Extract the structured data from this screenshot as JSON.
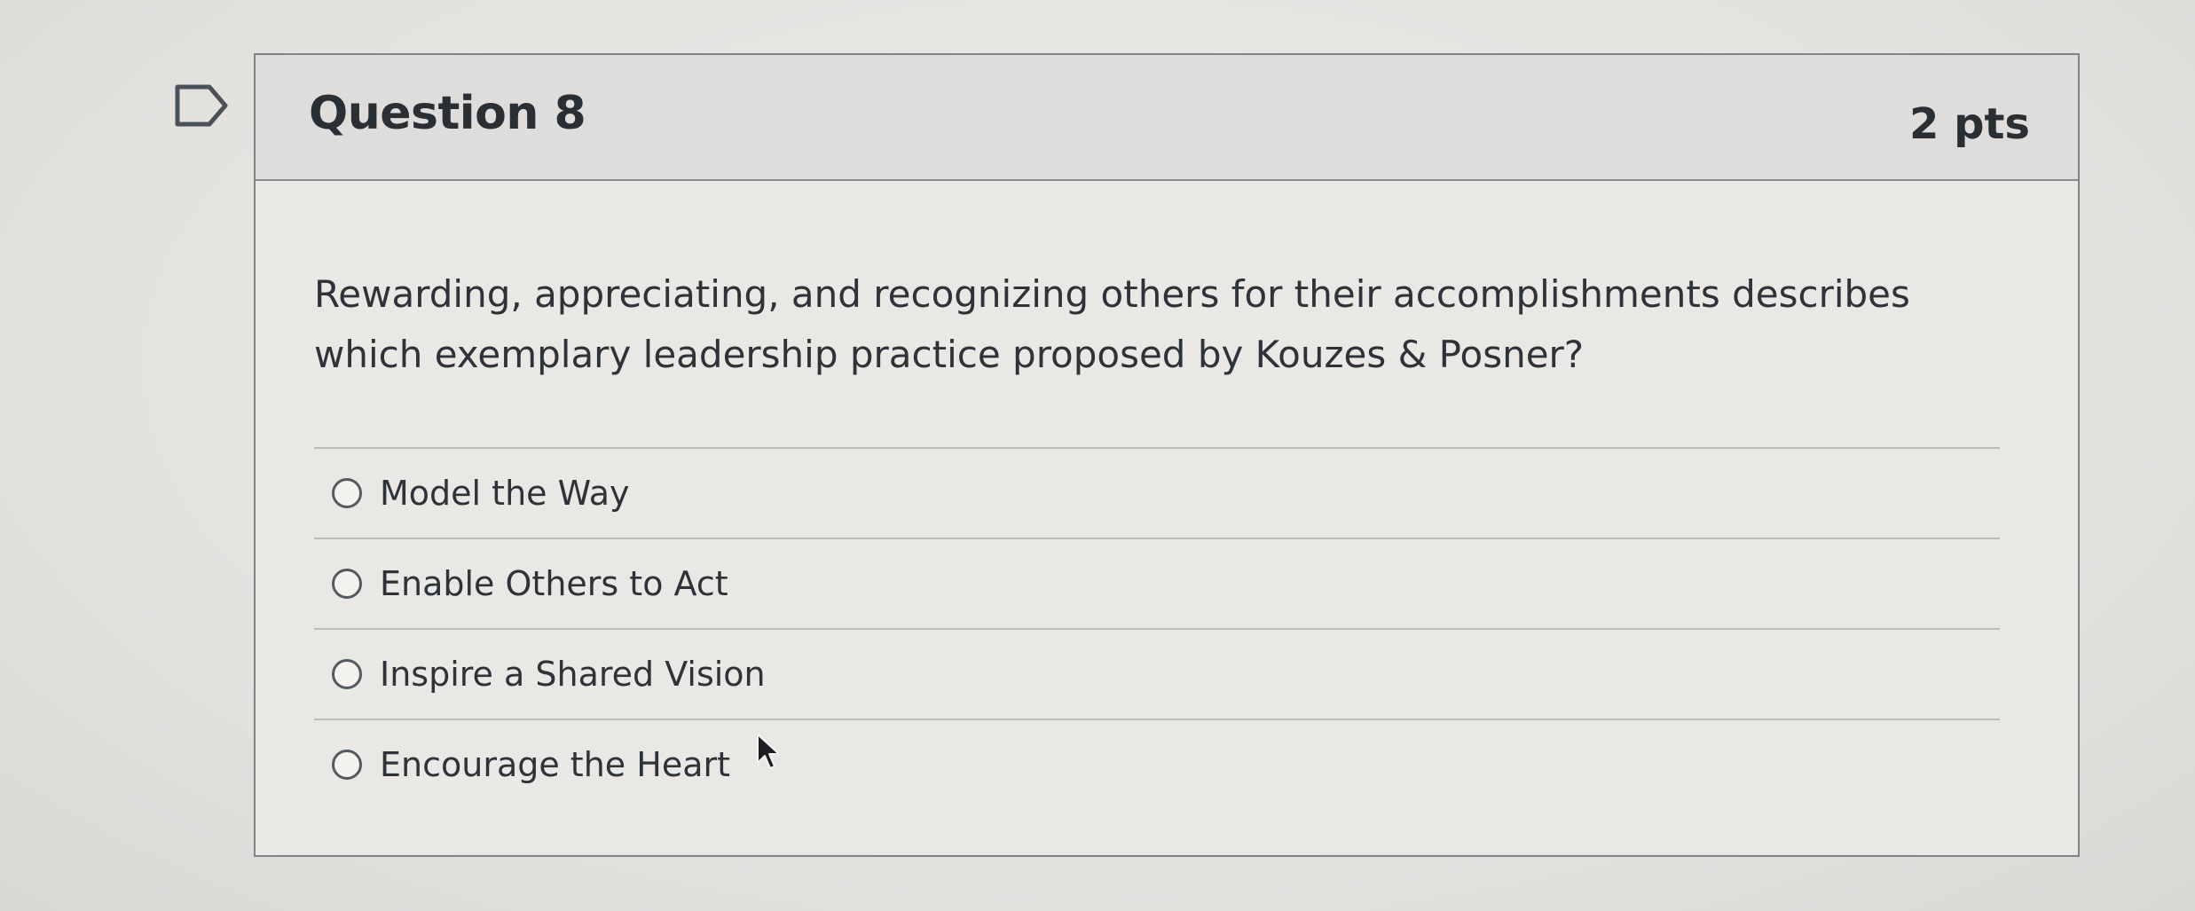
{
  "question": {
    "title": "Question 8",
    "points": "2 pts",
    "text": "Rewarding, appreciating, and recognizing others for their accomplishments describes which exemplary leadership practice proposed by Kouzes & Posner?"
  },
  "answers": [
    {
      "label": "Model the Way"
    },
    {
      "label": "Enable Others to Act"
    },
    {
      "label": "Inspire a Shared Vision"
    },
    {
      "label": "Encourage the Heart"
    }
  ],
  "icons": {
    "flag": "flag-icon",
    "cursor": "mouse-pointer-icon"
  }
}
